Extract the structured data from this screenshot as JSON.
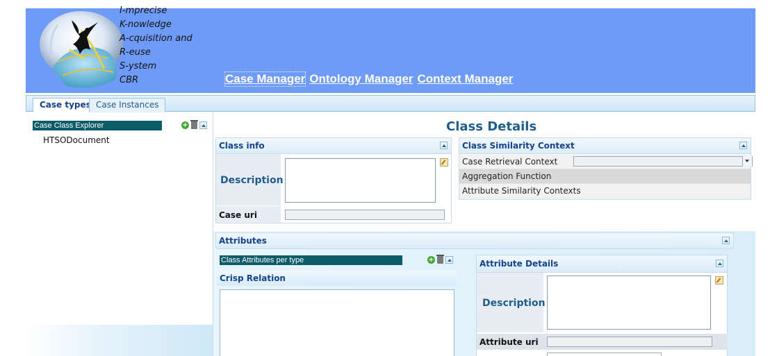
{
  "header": {
    "tagline": [
      "I-mprecise",
      "K-nowledge",
      "A-cquisition and",
      "R-euse",
      "S-ystem",
      "CBR"
    ],
    "nav": [
      "Case Manager",
      "Ontology Manager",
      "Context Manager"
    ]
  },
  "tabs": [
    "Case types",
    "Case Instances"
  ],
  "explorer": {
    "title": "Case Class Explorer",
    "items": [
      "HTSODocument"
    ]
  },
  "main": {
    "title": "Class Details",
    "class_info": {
      "title": "Class info",
      "description_label": "Description",
      "description_value": "",
      "uri_label": "Case uri",
      "uri_value": ""
    },
    "similarity": {
      "title": "Class Similarity Context",
      "rows": [
        "Case Retrieval Context",
        "Aggregation Function",
        "Attribute Similarity Contexts"
      ],
      "retrieval_value": ""
    },
    "attributes": {
      "title": "Attributes",
      "list_title": "Class Attributes per type",
      "crisp_relation": "Crisp Relation",
      "details": {
        "title": "Attribute Details",
        "description_label": "Description",
        "uri_label": "Attribute uri"
      }
    }
  },
  "colors": {
    "header_bg": "#6f9bf8",
    "accent": "#1f5d8c",
    "selection": "#0c5b68"
  }
}
